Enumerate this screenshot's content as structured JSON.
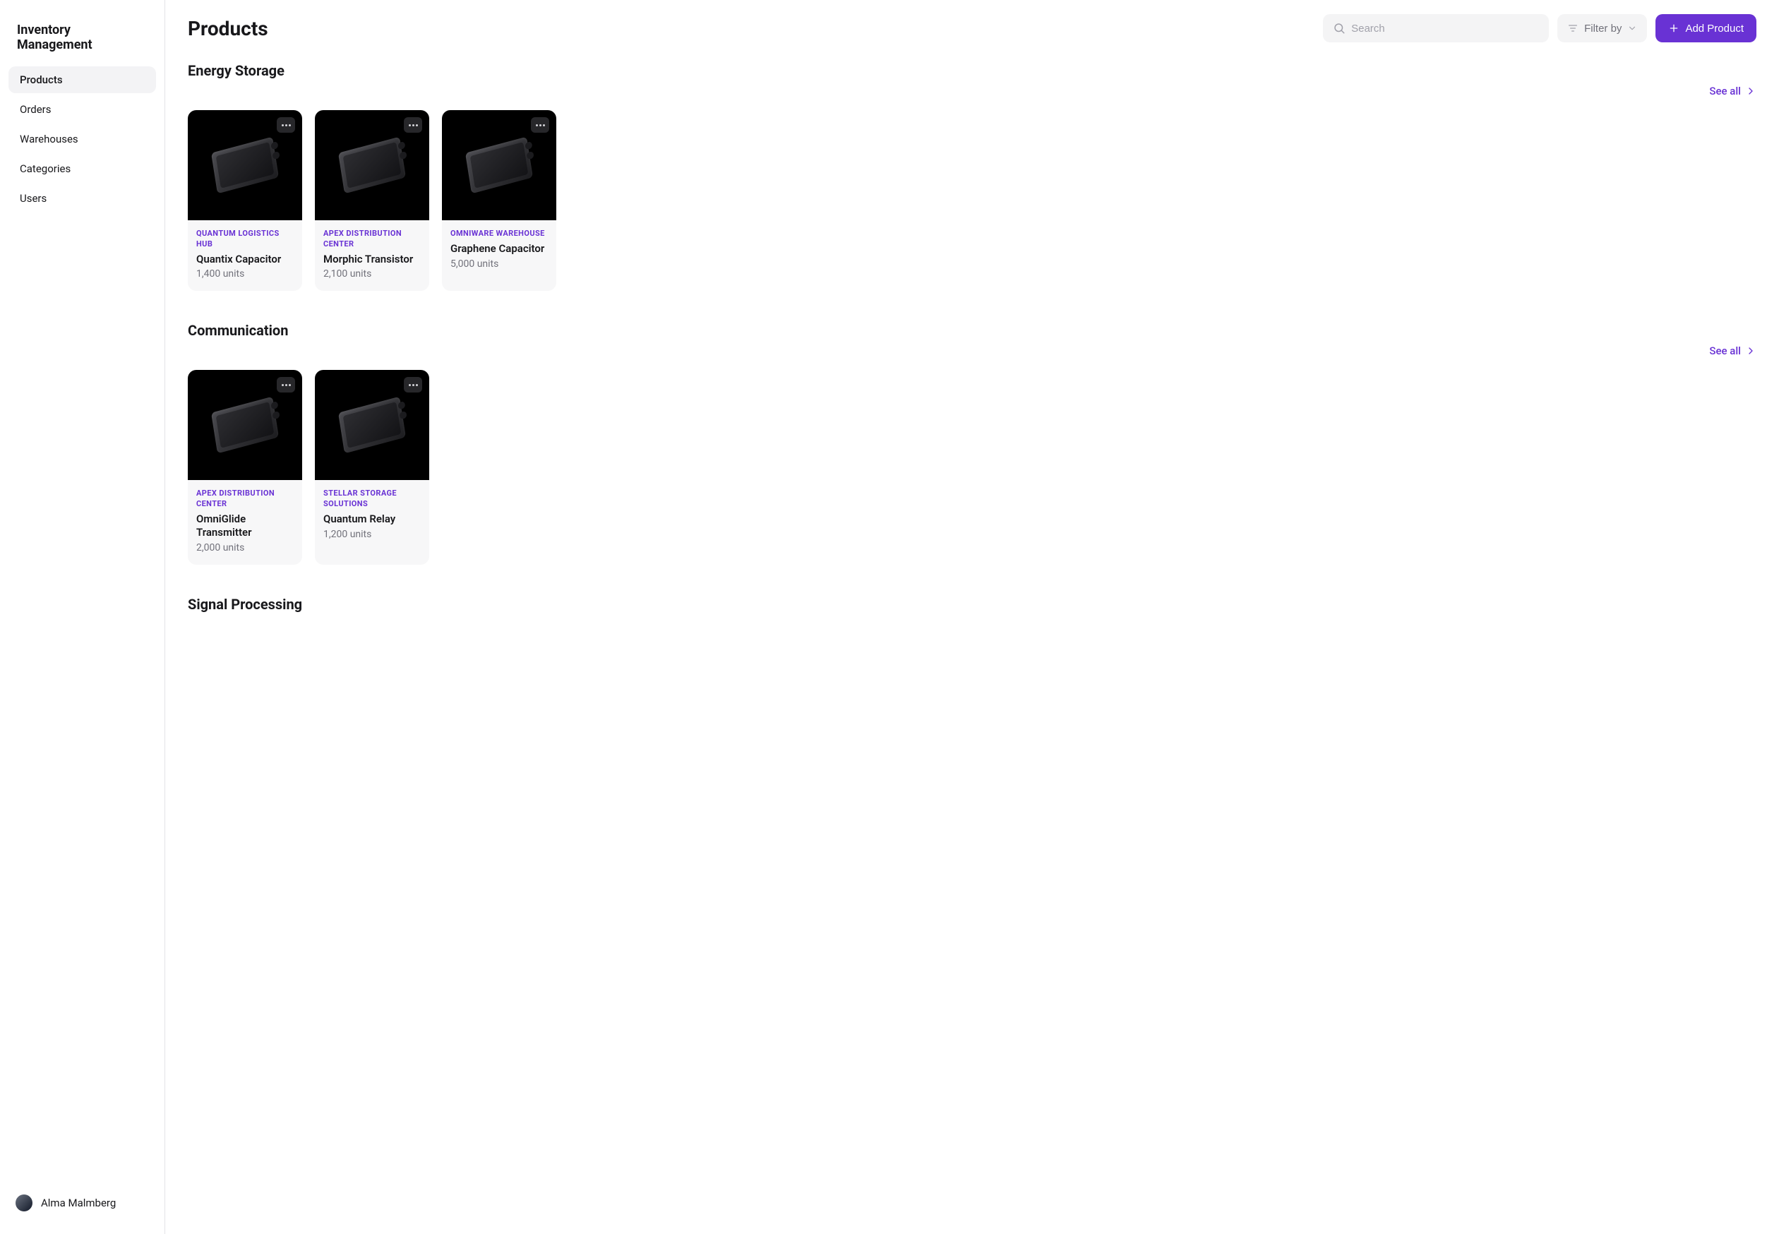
{
  "sidebar": {
    "title": "Inventory Management",
    "nav": [
      {
        "label": "Products",
        "active": true
      },
      {
        "label": "Orders",
        "active": false
      },
      {
        "label": "Warehouses",
        "active": false
      },
      {
        "label": "Categories",
        "active": false
      },
      {
        "label": "Users",
        "active": false
      }
    ],
    "user": {
      "name": "Alma Malmberg"
    }
  },
  "header": {
    "title": "Products",
    "search_placeholder": "Search",
    "filter_label": "Filter by",
    "add_label": "Add Product"
  },
  "see_all_label": "See all",
  "sections": [
    {
      "title": "Energy Storage",
      "products": [
        {
          "warehouse": "QUANTUM LOGISTICS HUB",
          "name": "Quantix Capacitor",
          "units": "1,400 units"
        },
        {
          "warehouse": "APEX DISTRIBUTION CENTER",
          "name": "Morphic Transistor",
          "units": "2,100 units"
        },
        {
          "warehouse": "OMNIWARE WAREHOUSE",
          "name": "Graphene Capacitor",
          "units": "5,000 units"
        }
      ]
    },
    {
      "title": "Communication",
      "products": [
        {
          "warehouse": "APEX DISTRIBUTION CENTER",
          "name": "OmniGlide Transmitter",
          "units": "2,000 units"
        },
        {
          "warehouse": "STELLAR STORAGE SOLUTIONS",
          "name": "Quantum Relay",
          "units": "1,200 units"
        }
      ]
    },
    {
      "title": "Signal Processing",
      "products": []
    }
  ]
}
